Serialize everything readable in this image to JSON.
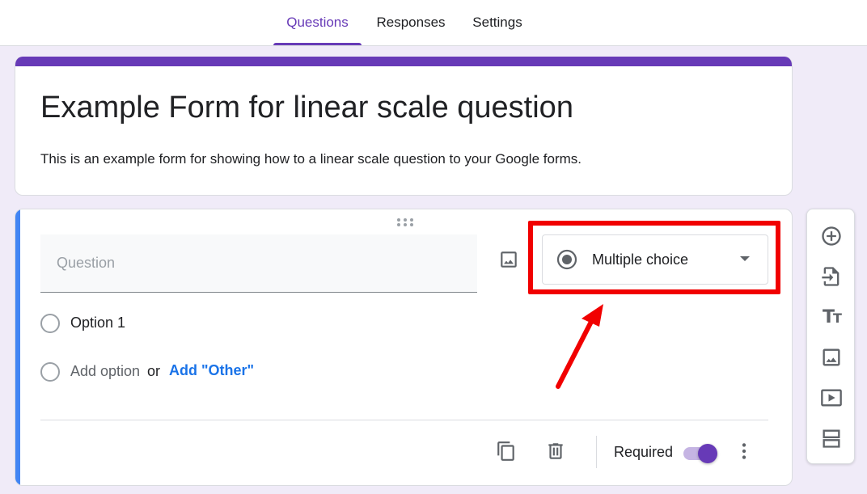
{
  "tabs": [
    {
      "label": "Questions",
      "active": true
    },
    {
      "label": "Responses",
      "active": false
    },
    {
      "label": "Settings",
      "active": false
    }
  ],
  "form": {
    "title": "Example Form for linear scale question",
    "description": "This is an example form for showing how to a linear scale question to your Google forms."
  },
  "question": {
    "placeholder": "Question",
    "type_label": "Multiple choice",
    "options": [
      {
        "label": "Option 1"
      }
    ],
    "add_option_label": "Add option",
    "or_label": "or",
    "add_other_label": "Add \"Other\"",
    "required_label": "Required",
    "required_on": true
  },
  "colors": {
    "accent": "#673ab7",
    "question_focus": "#4285f4",
    "link": "#1a73e8",
    "highlight": "#f10000"
  },
  "icons": {
    "drag_handle": "drag-dots-icon",
    "image": "image-icon",
    "type_radio": "radio-button-icon",
    "dropdown": "caret-down-icon",
    "duplicate": "copy-icon",
    "delete": "trash-icon",
    "more": "more-vert-icon",
    "side": [
      "add-circle-icon",
      "import-icon",
      "title-text-icon",
      "image-icon",
      "video-icon",
      "section-icon"
    ]
  }
}
